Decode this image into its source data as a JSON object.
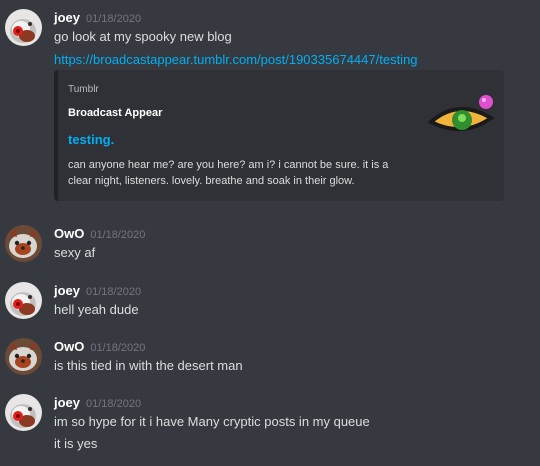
{
  "messages": [
    {
      "author": "joey",
      "timestamp": "01/18/2020",
      "lines": [
        "go look at my spooky new blog"
      ],
      "link": "https://broadcastappear.tumblr.com/post/190335674447/testing",
      "embed": {
        "provider": "Tumblr",
        "author": "Broadcast Appear",
        "title": "testing.",
        "description": "can anyone hear me? are you here? am i? i cannot be sure. it is a clear night, listeners. lovely. breathe and soak in their glow."
      }
    },
    {
      "author": "OwO",
      "timestamp": "01/18/2020",
      "lines": [
        "sexy af"
      ]
    },
    {
      "author": "joey",
      "timestamp": "01/18/2020",
      "lines": [
        "hell yeah dude"
      ]
    },
    {
      "author": "OwO",
      "timestamp": "01/18/2020",
      "lines": [
        "is this tied in with the desert man"
      ]
    },
    {
      "author": "joey",
      "timestamp": "01/18/2020",
      "lines": [
        "im so hype for it i have Many cryptic posts in my queue",
        "it is yes"
      ]
    }
  ],
  "colors": {
    "background": "#36393f",
    "embed_background": "#2f3136",
    "link": "#00b0f4",
    "timestamp": "#72767d",
    "author": "#ffffff",
    "text": "#dcddde"
  },
  "icons": {
    "joey_avatar": "red-panda-with-red-flower-avatar",
    "owo_avatar": "red-panda-avatar",
    "embed_thumbnail": "eye-icon"
  }
}
